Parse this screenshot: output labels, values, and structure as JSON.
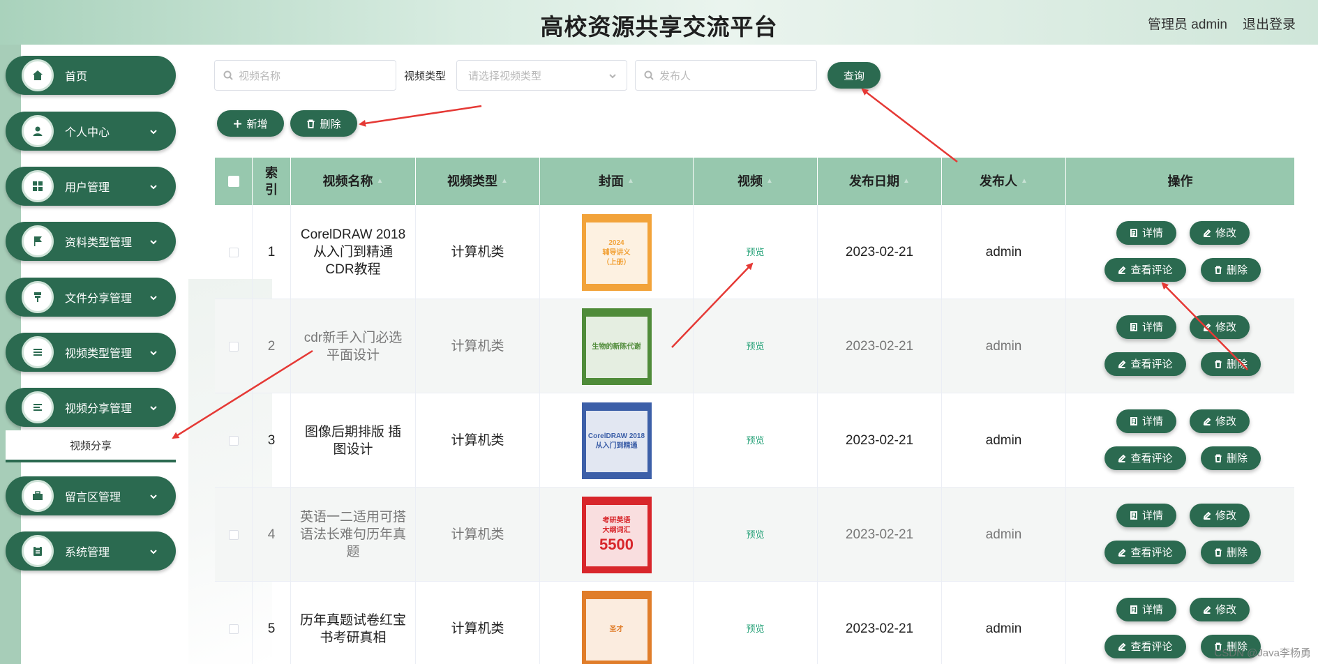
{
  "header": {
    "title": "高校资源共享交流平台",
    "user": "管理员 admin",
    "logout": "退出登录"
  },
  "sidebar": {
    "items": [
      {
        "label": "首页",
        "icon": "home-icon",
        "has_caret": false
      },
      {
        "label": "个人中心",
        "icon": "user-icon",
        "has_caret": true
      },
      {
        "label": "用户管理",
        "icon": "grid-icon",
        "has_caret": true
      },
      {
        "label": "资料类型管理",
        "icon": "flag-icon",
        "has_caret": true
      },
      {
        "label": "文件分享管理",
        "icon": "pin-icon",
        "has_caret": true
      },
      {
        "label": "视频类型管理",
        "icon": "list-icon",
        "has_caret": true
      },
      {
        "label": "视频分享管理",
        "icon": "menu-icon",
        "has_caret": true
      },
      {
        "label": "留言区管理",
        "icon": "briefcase-icon",
        "has_caret": true
      },
      {
        "label": "系统管理",
        "icon": "clipboard-icon",
        "has_caret": true
      }
    ],
    "submenu_active": "视频分享"
  },
  "search": {
    "name_placeholder": "视频名称",
    "type_label": "视频类型",
    "type_placeholder": "请选择视频类型",
    "publisher_placeholder": "发布人",
    "query_button": "查询"
  },
  "toolbar": {
    "add_label": "新增",
    "delete_label": "删除"
  },
  "table": {
    "columns": [
      "索引",
      "视频名称",
      "视频类型",
      "封面",
      "视频",
      "发布日期",
      "发布人",
      "操作"
    ],
    "rows": [
      {
        "index": "1",
        "name": "CorelDRAW 2018 从入门到精通CDR教程",
        "type": "计算机类",
        "video": "预览",
        "date": "2023-02-21",
        "publisher": "admin"
      },
      {
        "index": "2",
        "name": "cdr新手入门必选 平面设计",
        "type": "计算机类",
        "video": "预览",
        "date": "2023-02-21",
        "publisher": "admin"
      },
      {
        "index": "3",
        "name": "图像后期排版 插图设计",
        "type": "计算机类",
        "video": "预览",
        "date": "2023-02-21",
        "publisher": "admin"
      },
      {
        "index": "4",
        "name": "英语一二适用可搭 语法长难句历年真题",
        "type": "计算机类",
        "video": "预览",
        "date": "2023-02-21",
        "publisher": "admin"
      },
      {
        "index": "5",
        "name": "历年真题试卷红宝 书考研真相",
        "type": "计算机类",
        "video": "预览",
        "date": "2023-02-21",
        "publisher": "admin"
      }
    ],
    "actions": {
      "detail": "详情",
      "edit": "修改",
      "comments": "查看评论",
      "delete": "删除"
    },
    "covers": [
      {
        "text_1": "2024",
        "text_2": "辅导讲义",
        "text_3": "（上册）",
        "color": "#f2a33a"
      },
      {
        "text_1": "生物的新陈代谢",
        "color": "#4f8b39"
      },
      {
        "text_1": "CorelDRAW 2018",
        "text_2": "从入门到精通",
        "color": "#3c5fa8"
      },
      {
        "text_1": "考研英语",
        "text_2": "大纲词汇",
        "text_3": "5500",
        "color": "#d8262b"
      },
      {
        "text_1": "圣才",
        "color": "#e07d2a"
      }
    ]
  },
  "watermark": "CSDN @Java李杨勇",
  "colors": {
    "primary": "#2b6a50",
    "header_table": "#97c8ae",
    "preview_link": "#29a37a",
    "arrow": "#e53935"
  }
}
